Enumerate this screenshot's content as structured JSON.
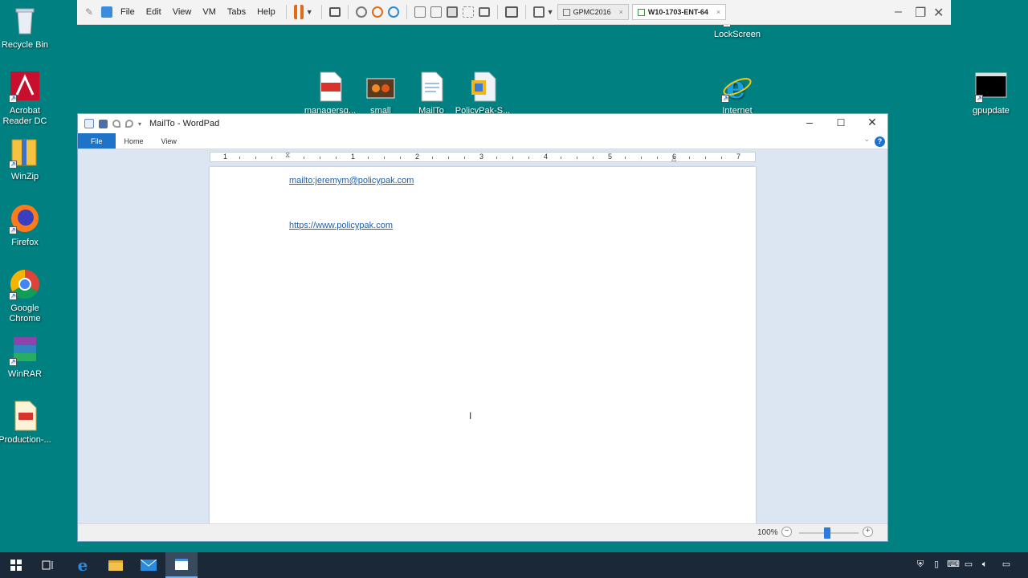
{
  "desktop": {
    "icons": [
      {
        "label": "Recycle Bin",
        "icon": "recycle-bin-icon"
      },
      {
        "label": "Acrobat Reader DC",
        "icon": "acrobat-icon"
      },
      {
        "label": "WinZip",
        "icon": "winzip-icon"
      },
      {
        "label": "Firefox",
        "icon": "firefox-icon"
      },
      {
        "label": "Google Chrome",
        "icon": "chrome-icon"
      },
      {
        "label": "WinRAR",
        "icon": "winrar-icon"
      },
      {
        "label": "Production-...",
        "icon": "pdf-file-icon"
      },
      {
        "label": "managersg...",
        "icon": "pdf-file-icon"
      },
      {
        "label": "small",
        "icon": "image-file-icon"
      },
      {
        "label": "MailTo",
        "icon": "document-icon"
      },
      {
        "label": "PolicyPak-S...",
        "icon": "policypak-icon"
      },
      {
        "label": "LockScreen",
        "icon": "shortcut-icon"
      },
      {
        "label": "Internet",
        "icon": "internet-explorer-icon"
      },
      {
        "label": "gpupdate",
        "icon": "console-icon"
      }
    ]
  },
  "vmware": {
    "menu": [
      "File",
      "Edit",
      "View",
      "VM",
      "Tabs",
      "Help"
    ],
    "tabs": [
      {
        "label": "GPMC2016",
        "active": false
      },
      {
        "label": "W10-1703-ENT-64",
        "active": true
      }
    ],
    "close_glyph": "×"
  },
  "wordpad": {
    "title": "MailTo - WordPad",
    "ribbon_tabs": [
      "File",
      "Home",
      "View"
    ],
    "help_glyph": "?",
    "ruler_numbers": [
      "1",
      "1",
      "2",
      "3",
      "4",
      "5",
      "6",
      "7"
    ],
    "document": {
      "lines": [
        "mailto:jeremym@policypak.com",
        "https://www.policypak.com"
      ]
    },
    "cursor_glyph": "I",
    "status": {
      "zoom": "100%",
      "zoom_out": "−",
      "zoom_in": "+"
    }
  },
  "colors": {
    "desktop": "#008080",
    "accent": "#1e73c8",
    "link": "#1f5fa8"
  }
}
